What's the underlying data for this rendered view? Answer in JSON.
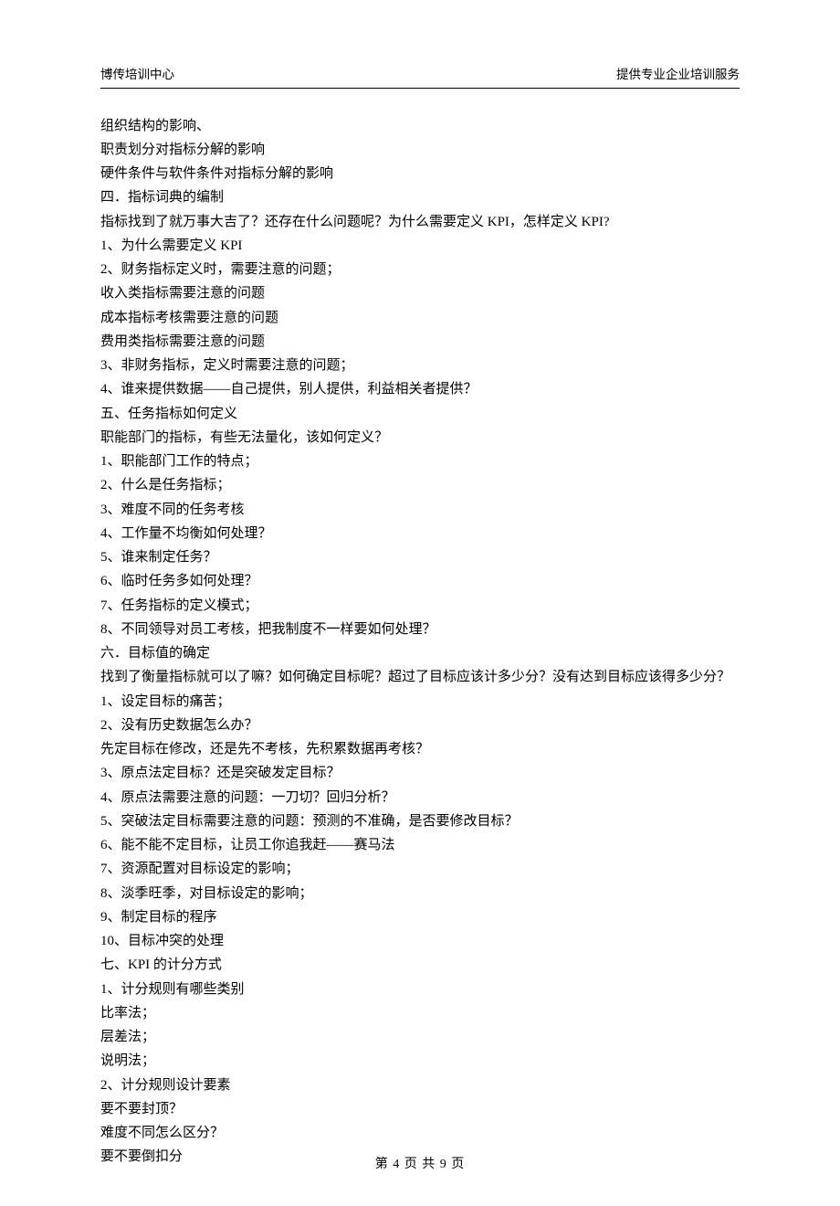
{
  "header": {
    "left": "博传培训中心",
    "right": "提供专业企业培训服务"
  },
  "lines": [
    {
      "cls": "indent1",
      "text": "组织结构的影响、"
    },
    {
      "cls": "indent1",
      "text": "职责划分对指标分解的影响"
    },
    {
      "cls": "indent1",
      "text": "硬件条件与软件条件对指标分解的影响"
    },
    {
      "cls": "",
      "text": "四．指标词典的编制"
    },
    {
      "cls": "",
      "text": "指标找到了就万事大吉了？还存在什么问题呢？为什么需要定义 KPI，怎样定义 KPI?"
    },
    {
      "cls": "",
      "text": "1、为什么需要定义 KPI"
    },
    {
      "cls": "",
      "text": "2、财务指标定义时，需要注意的问题；"
    },
    {
      "cls": "indent1",
      "text": "收入类指标需要注意的问题"
    },
    {
      "cls": "indent1",
      "text": "成本指标考核需要注意的问题"
    },
    {
      "cls": "indent1",
      "text": "费用类指标需要注意的问题"
    },
    {
      "cls": "",
      "text": "3、非财务指标，定义时需要注意的问题；"
    },
    {
      "cls": "",
      "text": "4、谁来提供数据——自己提供，别人提供，利益相关者提供？"
    },
    {
      "cls": "",
      "text": "五、任务指标如何定义"
    },
    {
      "cls": "",
      "text": "职能部门的指标，有些无法量化，该如何定义？"
    },
    {
      "cls": "",
      "text": "1、职能部门工作的特点；"
    },
    {
      "cls": "",
      "text": "2、什么是任务指标；"
    },
    {
      "cls": "",
      "text": "3、难度不同的任务考核"
    },
    {
      "cls": "",
      "text": "4、工作量不均衡如何处理？"
    },
    {
      "cls": "",
      "text": "5、谁来制定任务？"
    },
    {
      "cls": "",
      "text": "6、临时任务多如何处理？"
    },
    {
      "cls": "",
      "text": "7、任务指标的定义模式；"
    },
    {
      "cls": "",
      "text": "8、不同领导对员工考核，把我制度不一样要如何处理？"
    },
    {
      "cls": "",
      "text": "六．目标值的确定"
    },
    {
      "cls": "",
      "text": "找到了衡量指标就可以了嘛？如何确定目标呢？超过了目标应该计多少分？没有达到目标应该得多少分？"
    },
    {
      "cls": "",
      "text": "1、设定目标的痛苦；"
    },
    {
      "cls": "",
      "text": "2、没有历史数据怎么办？"
    },
    {
      "cls": "indent1",
      "text": "先定目标在修改，还是先不考核，先积累数据再考核？"
    },
    {
      "cls": "",
      "text": "3、原点法定目标？还是突破发定目标？"
    },
    {
      "cls": "",
      "text": "4、原点法需要注意的问题：一刀切？回归分析？"
    },
    {
      "cls": "",
      "text": "5、突破法定目标需要注意的问题：预测的不准确，是否要修改目标？"
    },
    {
      "cls": "",
      "text": "6、能不能不定目标，让员工你追我赶——赛马法"
    },
    {
      "cls": "",
      "text": "7、资源配置对目标设定的影响；"
    },
    {
      "cls": "",
      "text": "8、淡季旺季，对目标设定的影响；"
    },
    {
      "cls": "",
      "text": "9、制定目标的程序"
    },
    {
      "cls": "",
      "text": "10、目标冲突的处理"
    },
    {
      "cls": "",
      "text": "七、KPI 的计分方式"
    },
    {
      "cls": "",
      "text": "1、计分规则有哪些类别"
    },
    {
      "cls": "indent1",
      "text": "比率法；"
    },
    {
      "cls": "indent1",
      "text": "层差法；"
    },
    {
      "cls": "indent1",
      "text": "说明法；"
    },
    {
      "cls": "",
      "text": "2、计分规则设计要素"
    },
    {
      "cls": "indent1",
      "text": "要不要封顶？"
    },
    {
      "cls": "indent1",
      "text": "难度不同怎么区分？"
    },
    {
      "cls": "indent1",
      "text": "要不要倒扣分"
    }
  ],
  "footer": {
    "text": "第 4 页 共 9 页"
  }
}
